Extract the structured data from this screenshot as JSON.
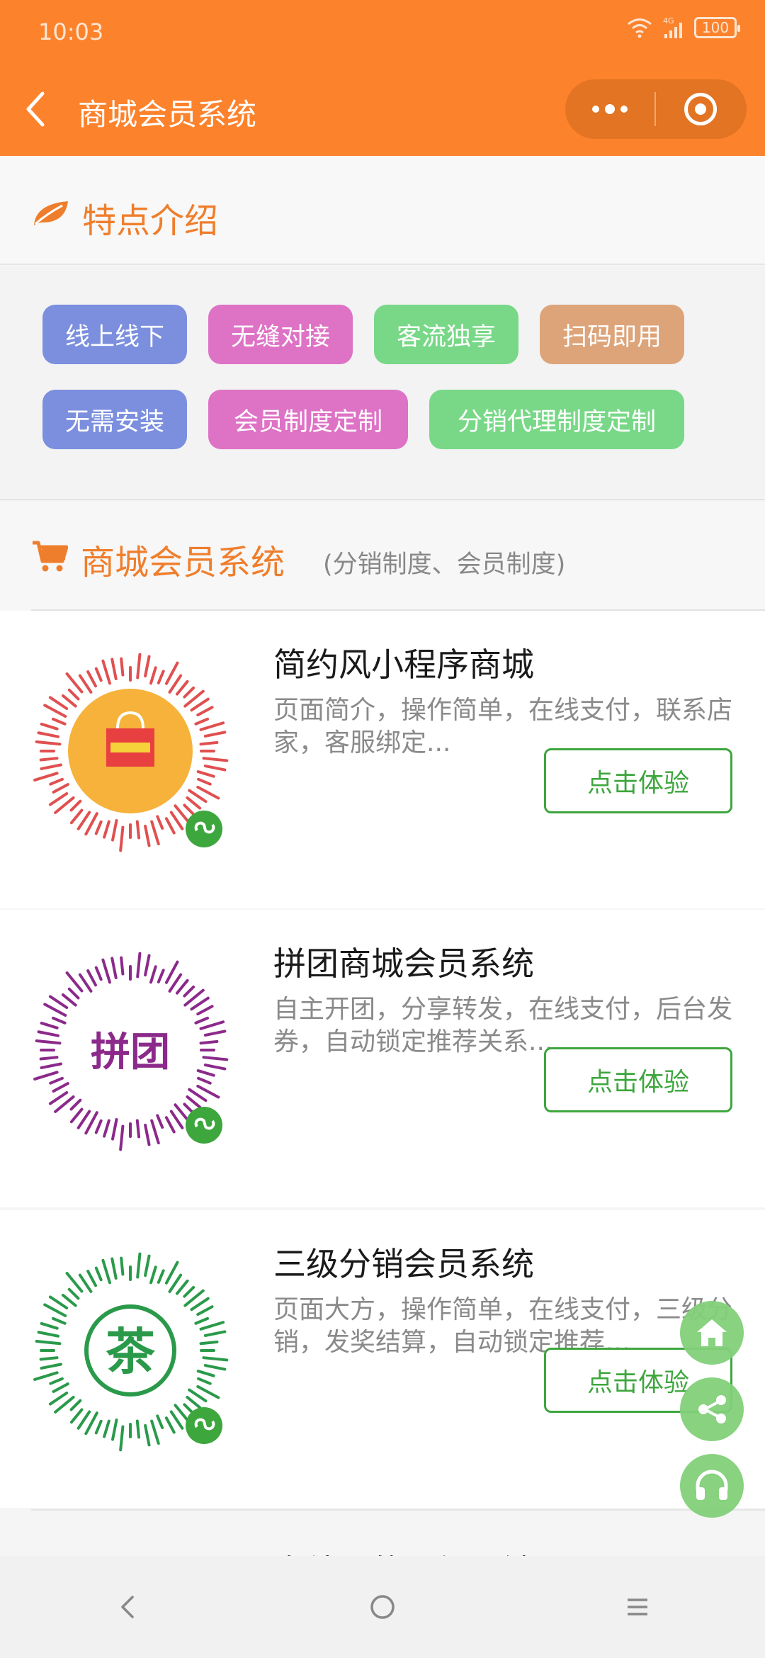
{
  "status_bar": {
    "time": "10:03",
    "network": "4G",
    "battery": "100"
  },
  "nav": {
    "title": "商城会员系统",
    "back_icon": "chevron-left-icon",
    "more_icon": "more-dots-icon",
    "close_icon": "target-close-icon"
  },
  "features": {
    "title": "特点介绍",
    "icon": "leaf-icon",
    "tags": [
      {
        "label": "线上线下",
        "color": "#7b8fde"
      },
      {
        "label": "无缝对接",
        "color": "#de72c5"
      },
      {
        "label": "客流独享",
        "color": "#78d887"
      },
      {
        "label": "扫码即用",
        "color": "#dda47a"
      },
      {
        "label": "无需安装",
        "color": "#7b8fde"
      },
      {
        "label": "会员制度定制",
        "color": "#de72c5"
      },
      {
        "label": "分销代理制度定制",
        "color": "#78d887"
      }
    ]
  },
  "mall": {
    "title": "商城会员系统",
    "subtitle": "(分销制度、会员制度)",
    "icon": "cart-icon",
    "products": [
      {
        "name": "简约风小程序商城",
        "desc": "页面简介，操作简单，在线支付，联系店家，客服绑定...",
        "button": "点击体验",
        "qr_label": "",
        "qr_color": "#e05050"
      },
      {
        "name": "拼团商城会员系统",
        "desc": "自主开团，分享转发，在线支付，后台发券，自动锁定推荐关系...",
        "button": "点击体验",
        "qr_label": "拼团",
        "qr_color": "#8b2a8a"
      },
      {
        "name": "三级分销会员系统",
        "desc": "页面大方，操作简单，在线支付，三级分销，发奖结算，自动锁定推荐…",
        "button": "点击体验",
        "qr_label": "茶",
        "qr_color": "#2a9a4a"
      }
    ],
    "peek_text": "多续码的三级分销"
  },
  "floating": [
    "home-icon",
    "share-icon",
    "headset-icon"
  ],
  "system_nav": [
    "back-icon",
    "home-circle-icon",
    "menu-icon"
  ]
}
